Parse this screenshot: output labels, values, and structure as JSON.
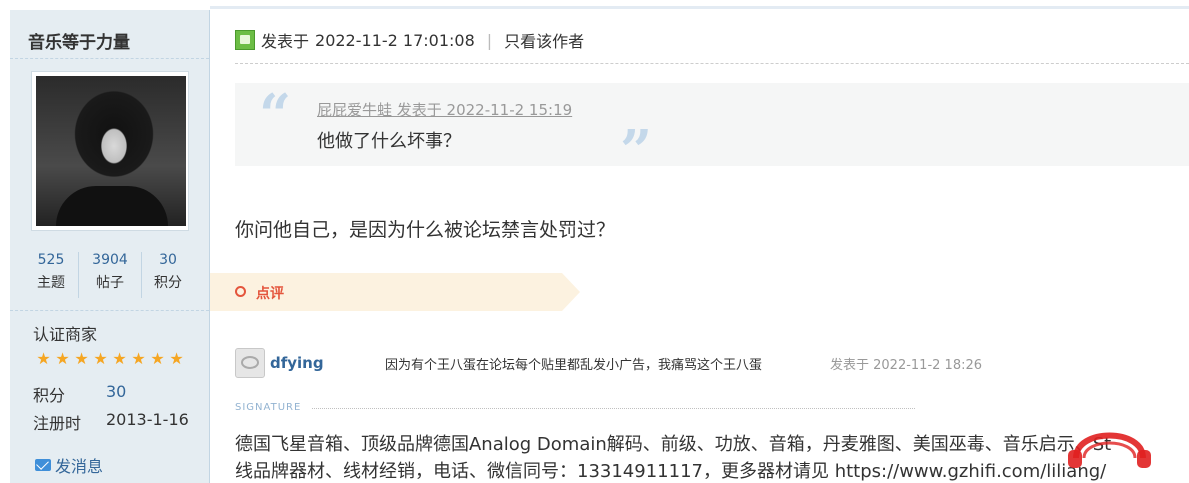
{
  "author": {
    "name": "音乐等于力量",
    "stats": [
      {
        "value": "525",
        "label": "主题"
      },
      {
        "value": "3904",
        "label": "帖子"
      },
      {
        "value": "30",
        "label": "积分"
      }
    ],
    "group": "认证商家",
    "star_count": 8,
    "points_label": "积分",
    "points_value": "30",
    "reg_label": "注册时",
    "reg_value": "2013-1-16",
    "message_label": "发消息"
  },
  "post": {
    "posted_prefix": "发表于",
    "posted_time": "2022-11-2 17:01:08",
    "separator": "|",
    "only_author": "只看该作者",
    "quote": {
      "meta": "屁屁爱牛蛙 发表于 2022-11-2 15:19",
      "text": "他做了什么坏事？",
      "open_mark": "“",
      "close_mark": "”"
    },
    "reply": "你问他自己，是因为什么被论坛禁言处罚过？"
  },
  "comments": {
    "tab_label": "点评",
    "items": [
      {
        "user": "dfying",
        "text": "因为有个王八蛋在论坛每个贴里都乱发小广告，我痛骂这个王八蛋",
        "time": "发表于 2022-11-2 18:26"
      }
    ]
  },
  "signature": {
    "label": "SIGNATURE",
    "line1": "德国飞星音箱、顶级品牌德国Analog Domain解码、前级、功放、音箱，丹麦雅图、美国巫毒、音乐启示、St",
    "line2": "线品牌器材、线材经销，电话、微信同号：13314911117，更多器材请见 https://www.gzhifi.com/liliang/"
  },
  "colors": {
    "link": "#336699",
    "sidebar_bg": "#e5edf2",
    "comment_accent": "#e4553c",
    "watermark": "#e02020"
  },
  "icons": {
    "online": "online-status-icon",
    "mail": "mail-icon",
    "star": "star-icon",
    "watermark": "headphones-logo"
  }
}
